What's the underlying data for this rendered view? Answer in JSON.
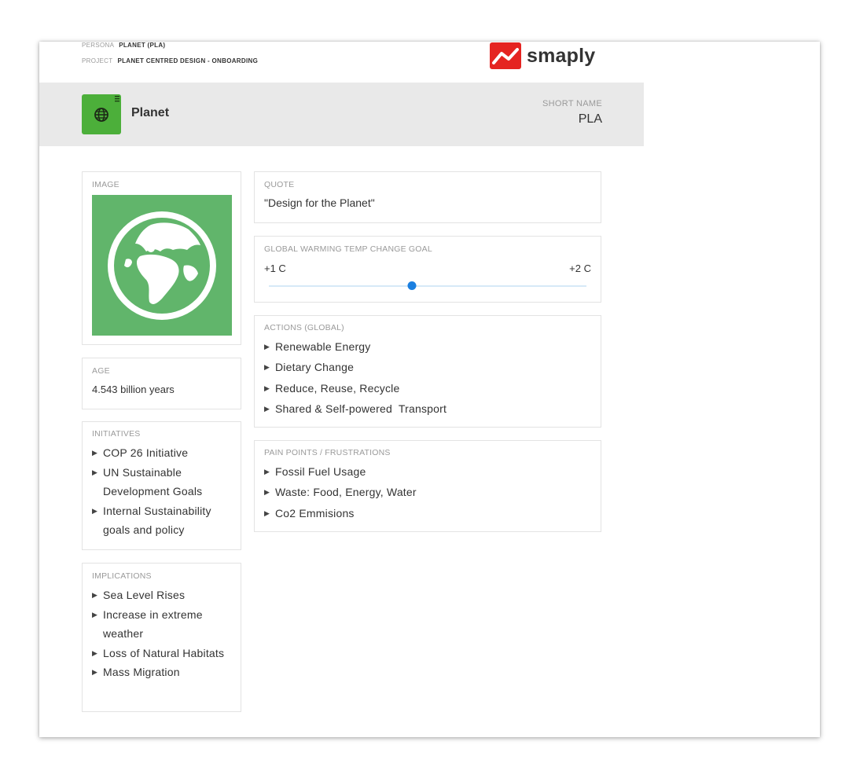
{
  "meta": {
    "persona_label": "PERSONA",
    "persona_value": "PLANET (PLA)",
    "project_label": "PROJECT",
    "project_value": "PLANET CENTRED DESIGN - ONBOARDING"
  },
  "brand": {
    "name": "smaply",
    "color": "#e52421"
  },
  "header": {
    "title": "Planet",
    "icon": "globe-icon",
    "icon_color": "#4caf3a",
    "short_name_label": "SHORT NAME",
    "short_name_value": "PLA"
  },
  "image_card": {
    "label": "IMAGE",
    "icon": "earth-globe-icon",
    "bg_color": "#61b56b"
  },
  "age_card": {
    "label": "AGE",
    "value": "4.543 billion years"
  },
  "initiatives": {
    "label": "INITIATIVES",
    "items": [
      "COP 26 Initiative",
      "UN Sustainable Development Goals",
      "Internal Sustainability goals and policy"
    ]
  },
  "implications": {
    "label": "IMPLICATIONS",
    "items": [
      "Sea Level Rises",
      "Increase in extreme weather",
      "Loss of Natural Habitats",
      "Mass Migration"
    ]
  },
  "quote": {
    "label": "QUOTE",
    "value": "\"Design for the Planet\""
  },
  "warming": {
    "label": "GLOBAL WARMING TEMP CHANGE GOAL",
    "min_label": "+1 C",
    "max_label": "+2 C",
    "value_fraction": 0.45,
    "thumb_color": "#1a7fe0"
  },
  "actions": {
    "label": "ACTIONS (GLOBAL)",
    "items": [
      "Renewable Energy",
      "Dietary Change",
      "Reduce, Reuse, Recycle",
      "Shared & Self-powered  Transport"
    ]
  },
  "pain_points": {
    "label": "PAIN POINTS / FRUSTRATIONS",
    "items": [
      "Fossil Fuel Usage",
      "Waste: Food, Energy, Water",
      "Co2 Emmisions"
    ]
  }
}
